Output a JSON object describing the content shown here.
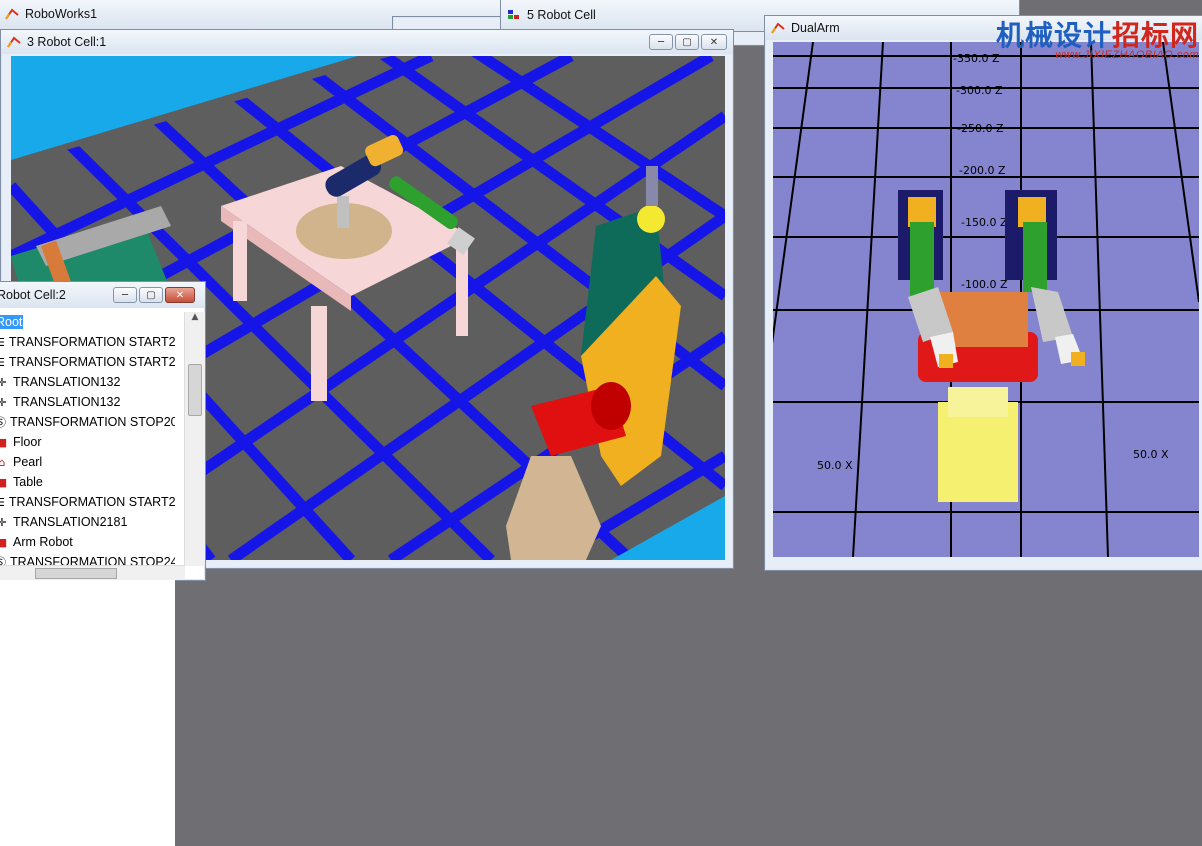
{
  "windows": {
    "main": {
      "title": "RoboWorks1"
    },
    "cell5": {
      "title": "5 Robot Cell"
    },
    "cell3": {
      "title": "3 Robot Cell:1"
    },
    "cell2": {
      "title": "Robot Cell:2"
    },
    "dualarm": {
      "title": "DualArm"
    }
  },
  "tree": {
    "items": [
      {
        "label": "Root",
        "icon": "none",
        "selected": true
      },
      {
        "label": "TRANSFORMATION START2",
        "icon": "transformation-start-icon"
      },
      {
        "label": "TRANSFORMATION START2",
        "icon": "transformation-start-icon"
      },
      {
        "label": "TRANSLATION132",
        "icon": "translation-icon"
      },
      {
        "label": "TRANSLATION132",
        "icon": "translation-icon"
      },
      {
        "label": "TRANSFORMATION STOP20",
        "icon": "stop-icon"
      },
      {
        "label": "Floor",
        "icon": "object-icon"
      },
      {
        "label": "Pearl",
        "icon": "pearl-icon"
      },
      {
        "label": "Table",
        "icon": "object-icon"
      },
      {
        "label": "TRANSFORMATION START2",
        "icon": "transformation-start-icon"
      },
      {
        "label": "TRANSLATION2181",
        "icon": "translation-icon"
      },
      {
        "label": "Arm Robot",
        "icon": "object-icon"
      },
      {
        "label": "TRANSFORMATION STOP24",
        "icon": "stop-icon"
      }
    ]
  },
  "dualarm_axis": {
    "z_labels": [
      "-350.0 Z",
      "-300.0 Z",
      "-250.0 Z",
      "-200.0 Z",
      "-150.0 Z",
      "-100.0 Z"
    ],
    "x_labels": [
      "50.0 X",
      "50.0 X"
    ]
  },
  "watermark": {
    "text_blue": "机械设计",
    "text_red": "招标网",
    "url": "www.JIXIEZHAOBIAO.com"
  },
  "colors": {
    "floor_blue": "#1515e8",
    "floor_gray": "#5e5e5e",
    "sky": "#17a9ea",
    "dual_floor": "#8585cf"
  }
}
